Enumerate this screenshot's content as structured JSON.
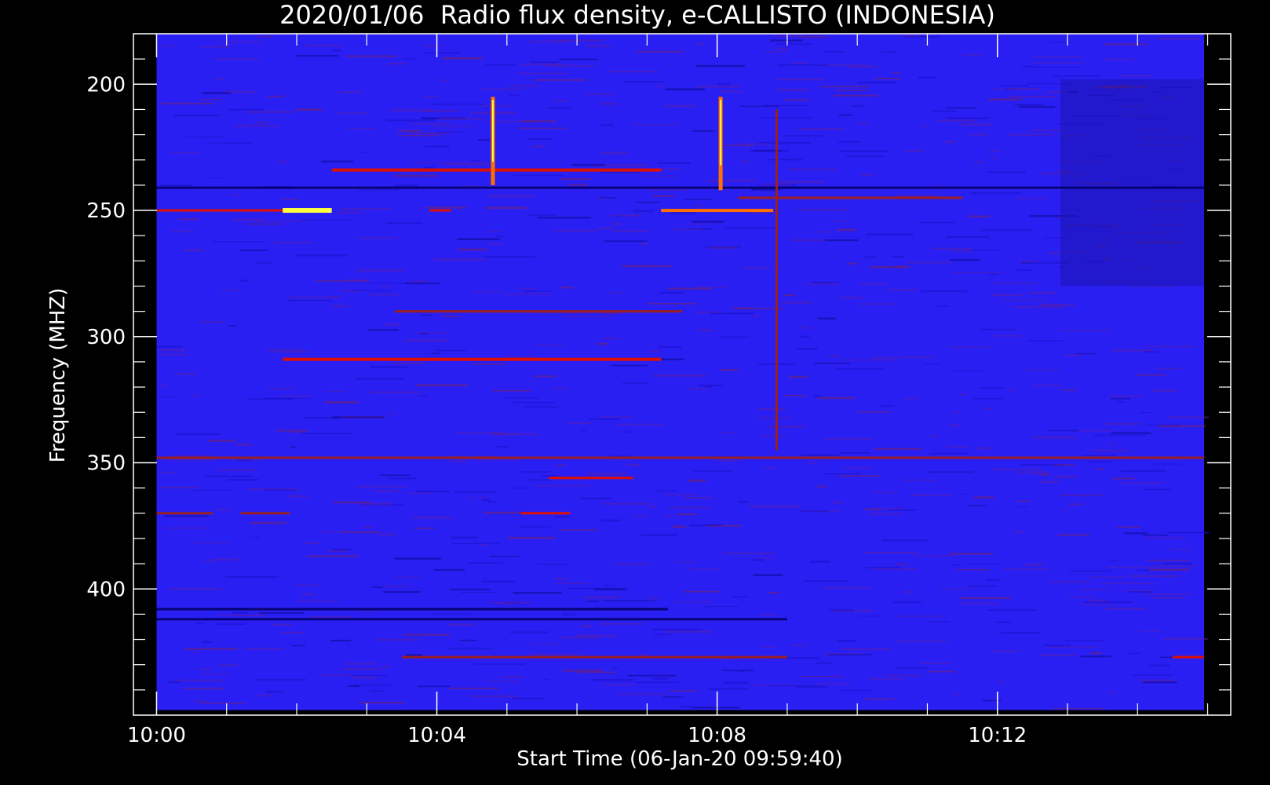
{
  "chart_data": {
    "type": "heatmap",
    "title": "2020/01/06  Radio flux density, e-CALLISTO (INDONESIA)",
    "xlabel": "Start Time (06-Jan-20 09:59:40)",
    "ylabel": "Frequency (MHZ)",
    "x_unit": "minutes after 10:00",
    "xlim": [
      -0.33,
      15.33
    ],
    "ylim": [
      450,
      180
    ],
    "y_inverted": true,
    "data_extent": {
      "x": [
        0.0,
        14.95
      ],
      "y": [
        180,
        448
      ]
    },
    "x_ticks": [
      {
        "value": 0,
        "label": "10:00"
      },
      {
        "value": 4,
        "label": "10:04"
      },
      {
        "value": 8,
        "label": "10:08"
      },
      {
        "value": 12,
        "label": "10:12"
      }
    ],
    "y_ticks": [
      {
        "value": 200,
        "label": "200"
      },
      {
        "value": 250,
        "label": "250"
      },
      {
        "value": 300,
        "label": "300"
      },
      {
        "value": 350,
        "label": "350"
      },
      {
        "value": 400,
        "label": "400"
      }
    ],
    "background_color": "#2a1ff2",
    "colormap": [
      "#000060",
      "#0000c8",
      "#2a1ff2",
      "#9a2020",
      "#e01000",
      "#ff7000",
      "#ffff40"
    ],
    "features": [
      {
        "kind": "horizontal",
        "freq": 234,
        "t": [
          2.5,
          7.2
        ],
        "level": 0.75
      },
      {
        "kind": "horizontal",
        "freq": 250,
        "t": [
          0.0,
          1.8
        ],
        "level": 0.6
      },
      {
        "kind": "horizontal",
        "freq": 250,
        "t": [
          1.8,
          2.5
        ],
        "level": 1.0
      },
      {
        "kind": "horizontal",
        "freq": 250,
        "t": [
          3.9,
          4.2
        ],
        "level": 0.6
      },
      {
        "kind": "horizontal",
        "freq": 250,
        "t": [
          7.2,
          8.8
        ],
        "level": 0.85
      },
      {
        "kind": "horizontal",
        "freq": 245,
        "t": [
          8.3,
          11.5
        ],
        "level": 0.5
      },
      {
        "kind": "horizontal",
        "freq": 309,
        "t": [
          1.8,
          7.2
        ],
        "level": 0.75
      },
      {
        "kind": "horizontal",
        "freq": 290,
        "t": [
          3.4,
          7.5
        ],
        "level": 0.45
      },
      {
        "kind": "horizontal",
        "freq": 348,
        "t": [
          0.0,
          14.95
        ],
        "level": 0.5
      },
      {
        "kind": "horizontal",
        "freq": 356,
        "t": [
          5.6,
          6.8
        ],
        "level": 0.65
      },
      {
        "kind": "horizontal",
        "freq": 370,
        "t": [
          0.0,
          0.8
        ],
        "level": 0.55
      },
      {
        "kind": "horizontal",
        "freq": 370,
        "t": [
          1.2,
          1.9
        ],
        "level": 0.55
      },
      {
        "kind": "horizontal",
        "freq": 370,
        "t": [
          5.2,
          5.9
        ],
        "level": 0.6
      },
      {
        "kind": "horizontal",
        "freq": 427,
        "t": [
          3.5,
          9.0
        ],
        "level": 0.5
      },
      {
        "kind": "horizontal",
        "freq": 427,
        "t": [
          14.5,
          14.95
        ],
        "level": 0.6
      },
      {
        "kind": "vertical",
        "t": 4.8,
        "freq": [
          205,
          240
        ],
        "level": 0.9
      },
      {
        "kind": "vertical",
        "t": 8.05,
        "freq": [
          205,
          242
        ],
        "level": 0.9
      },
      {
        "kind": "vertical",
        "t": 8.85,
        "freq": [
          210,
          345
        ],
        "level": 0.55
      }
    ],
    "dark_bands": [
      {
        "freq": 241,
        "t": [
          0.0,
          14.95
        ]
      },
      {
        "freq": 412,
        "t": [
          0.0,
          9.0
        ]
      },
      {
        "freq": 408,
        "t": [
          0.0,
          7.3
        ]
      }
    ]
  }
}
